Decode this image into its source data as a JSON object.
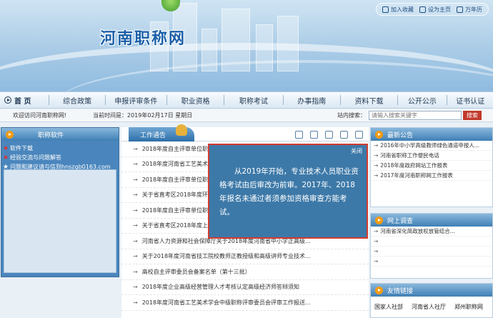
{
  "header": {
    "site_title": "河南职称网",
    "top_links": [
      "加入收藏",
      "设为主页",
      "万年历"
    ]
  },
  "nav": {
    "home": "首 页",
    "items": [
      "综合政策",
      "申报评审条件",
      "职业资格",
      "职称考试",
      "办事指南",
      "资料下载",
      "公开公示",
      "证书认证"
    ]
  },
  "status": {
    "welcome": "欢迎访问河南职称网!",
    "time_label": "当前时间是：",
    "time_value": "2019年02月17日  星期日",
    "search_label": "站内搜索：",
    "search_placeholder": "请输入搜索关键字",
    "search_button": "搜索"
  },
  "left_panel": {
    "title": "职称软件",
    "links": [
      "软件下载",
      "经验交流与问题解答",
      "问题和建议请与信到hnszgb0163.com"
    ]
  },
  "center_panel": {
    "tab": "工作通告",
    "news": [
      "2018年度自主评审单位职称...",
      "2018年度河南省工艺美术学...",
      "2018年度自主评审单位职称...",
      "关于省直考区2018年度环境...",
      "2018年度自主评审单位职称...",
      "关于省直考区2018年度上半...",
      "河南省人力资源和社会保障厅关于2018年度河南省中小学正高级...",
      "关于2018年度河南省技工院校教师正教授级和高级讲师专业技术...",
      "高校自主评审委员会备案名单（第十三批）",
      "2018年度企业高级经营管理人才考核认定高级经济师答辩须知",
      "2018年度河南省工艺美术学会中级职称评审委员会评审工作报送..."
    ]
  },
  "right_panels": {
    "notice_title": "最新公告",
    "notices": [
      "2016年中小学高级教师绿色通道申报人...",
      "河南省职称工作便民电话",
      "2018年度政府网站工作报表",
      "2017年度河南职称网工作报表"
    ],
    "survey_title": "网上调查",
    "surveys": [
      "河南省深化简政放权放管结合...",
      "",
      "",
      ""
    ],
    "friends_title": "友情链接",
    "friends": [
      "国家人社部",
      "河南省人社厅",
      "郑州职称网"
    ]
  },
  "popup": {
    "close": "关闭",
    "message": "从2019年开始，专业技术人员职业资格考试由后审改为前审。2017年、2018年报名未通过者须参加资格审查方能考试。"
  }
}
